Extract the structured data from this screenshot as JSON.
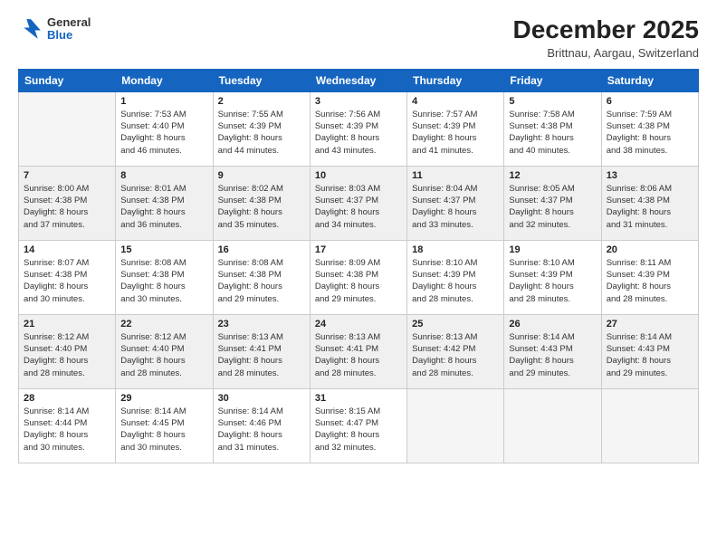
{
  "header": {
    "logo_general": "General",
    "logo_blue": "Blue",
    "month_title": "December 2025",
    "location": "Brittnau, Aargau, Switzerland"
  },
  "days_of_week": [
    "Sunday",
    "Monday",
    "Tuesday",
    "Wednesday",
    "Thursday",
    "Friday",
    "Saturday"
  ],
  "weeks": [
    [
      {
        "day": "",
        "sunrise": "",
        "sunset": "",
        "daylight": "",
        "empty": true
      },
      {
        "day": "1",
        "sunrise": "Sunrise: 7:53 AM",
        "sunset": "Sunset: 4:40 PM",
        "daylight": "Daylight: 8 hours",
        "daylight2": "and 46 minutes."
      },
      {
        "day": "2",
        "sunrise": "Sunrise: 7:55 AM",
        "sunset": "Sunset: 4:39 PM",
        "daylight": "Daylight: 8 hours",
        "daylight2": "and 44 minutes."
      },
      {
        "day": "3",
        "sunrise": "Sunrise: 7:56 AM",
        "sunset": "Sunset: 4:39 PM",
        "daylight": "Daylight: 8 hours",
        "daylight2": "and 43 minutes."
      },
      {
        "day": "4",
        "sunrise": "Sunrise: 7:57 AM",
        "sunset": "Sunset: 4:39 PM",
        "daylight": "Daylight: 8 hours",
        "daylight2": "and 41 minutes."
      },
      {
        "day": "5",
        "sunrise": "Sunrise: 7:58 AM",
        "sunset": "Sunset: 4:38 PM",
        "daylight": "Daylight: 8 hours",
        "daylight2": "and 40 minutes."
      },
      {
        "day": "6",
        "sunrise": "Sunrise: 7:59 AM",
        "sunset": "Sunset: 4:38 PM",
        "daylight": "Daylight: 8 hours",
        "daylight2": "and 38 minutes."
      }
    ],
    [
      {
        "day": "7",
        "sunrise": "Sunrise: 8:00 AM",
        "sunset": "Sunset: 4:38 PM",
        "daylight": "Daylight: 8 hours",
        "daylight2": "and 37 minutes."
      },
      {
        "day": "8",
        "sunrise": "Sunrise: 8:01 AM",
        "sunset": "Sunset: 4:38 PM",
        "daylight": "Daylight: 8 hours",
        "daylight2": "and 36 minutes."
      },
      {
        "day": "9",
        "sunrise": "Sunrise: 8:02 AM",
        "sunset": "Sunset: 4:38 PM",
        "daylight": "Daylight: 8 hours",
        "daylight2": "and 35 minutes."
      },
      {
        "day": "10",
        "sunrise": "Sunrise: 8:03 AM",
        "sunset": "Sunset: 4:37 PM",
        "daylight": "Daylight: 8 hours",
        "daylight2": "and 34 minutes."
      },
      {
        "day": "11",
        "sunrise": "Sunrise: 8:04 AM",
        "sunset": "Sunset: 4:37 PM",
        "daylight": "Daylight: 8 hours",
        "daylight2": "and 33 minutes."
      },
      {
        "day": "12",
        "sunrise": "Sunrise: 8:05 AM",
        "sunset": "Sunset: 4:37 PM",
        "daylight": "Daylight: 8 hours",
        "daylight2": "and 32 minutes."
      },
      {
        "day": "13",
        "sunrise": "Sunrise: 8:06 AM",
        "sunset": "Sunset: 4:38 PM",
        "daylight": "Daylight: 8 hours",
        "daylight2": "and 31 minutes."
      }
    ],
    [
      {
        "day": "14",
        "sunrise": "Sunrise: 8:07 AM",
        "sunset": "Sunset: 4:38 PM",
        "daylight": "Daylight: 8 hours",
        "daylight2": "and 30 minutes."
      },
      {
        "day": "15",
        "sunrise": "Sunrise: 8:08 AM",
        "sunset": "Sunset: 4:38 PM",
        "daylight": "Daylight: 8 hours",
        "daylight2": "and 30 minutes."
      },
      {
        "day": "16",
        "sunrise": "Sunrise: 8:08 AM",
        "sunset": "Sunset: 4:38 PM",
        "daylight": "Daylight: 8 hours",
        "daylight2": "and 29 minutes."
      },
      {
        "day": "17",
        "sunrise": "Sunrise: 8:09 AM",
        "sunset": "Sunset: 4:38 PM",
        "daylight": "Daylight: 8 hours",
        "daylight2": "and 29 minutes."
      },
      {
        "day": "18",
        "sunrise": "Sunrise: 8:10 AM",
        "sunset": "Sunset: 4:39 PM",
        "daylight": "Daylight: 8 hours",
        "daylight2": "and 28 minutes."
      },
      {
        "day": "19",
        "sunrise": "Sunrise: 8:10 AM",
        "sunset": "Sunset: 4:39 PM",
        "daylight": "Daylight: 8 hours",
        "daylight2": "and 28 minutes."
      },
      {
        "day": "20",
        "sunrise": "Sunrise: 8:11 AM",
        "sunset": "Sunset: 4:39 PM",
        "daylight": "Daylight: 8 hours",
        "daylight2": "and 28 minutes."
      }
    ],
    [
      {
        "day": "21",
        "sunrise": "Sunrise: 8:12 AM",
        "sunset": "Sunset: 4:40 PM",
        "daylight": "Daylight: 8 hours",
        "daylight2": "and 28 minutes."
      },
      {
        "day": "22",
        "sunrise": "Sunrise: 8:12 AM",
        "sunset": "Sunset: 4:40 PM",
        "daylight": "Daylight: 8 hours",
        "daylight2": "and 28 minutes."
      },
      {
        "day": "23",
        "sunrise": "Sunrise: 8:13 AM",
        "sunset": "Sunset: 4:41 PM",
        "daylight": "Daylight: 8 hours",
        "daylight2": "and 28 minutes."
      },
      {
        "day": "24",
        "sunrise": "Sunrise: 8:13 AM",
        "sunset": "Sunset: 4:41 PM",
        "daylight": "Daylight: 8 hours",
        "daylight2": "and 28 minutes."
      },
      {
        "day": "25",
        "sunrise": "Sunrise: 8:13 AM",
        "sunset": "Sunset: 4:42 PM",
        "daylight": "Daylight: 8 hours",
        "daylight2": "and 28 minutes."
      },
      {
        "day": "26",
        "sunrise": "Sunrise: 8:14 AM",
        "sunset": "Sunset: 4:43 PM",
        "daylight": "Daylight: 8 hours",
        "daylight2": "and 29 minutes."
      },
      {
        "day": "27",
        "sunrise": "Sunrise: 8:14 AM",
        "sunset": "Sunset: 4:43 PM",
        "daylight": "Daylight: 8 hours",
        "daylight2": "and 29 minutes."
      }
    ],
    [
      {
        "day": "28",
        "sunrise": "Sunrise: 8:14 AM",
        "sunset": "Sunset: 4:44 PM",
        "daylight": "Daylight: 8 hours",
        "daylight2": "and 30 minutes."
      },
      {
        "day": "29",
        "sunrise": "Sunrise: 8:14 AM",
        "sunset": "Sunset: 4:45 PM",
        "daylight": "Daylight: 8 hours",
        "daylight2": "and 30 minutes."
      },
      {
        "day": "30",
        "sunrise": "Sunrise: 8:14 AM",
        "sunset": "Sunset: 4:46 PM",
        "daylight": "Daylight: 8 hours",
        "daylight2": "and 31 minutes."
      },
      {
        "day": "31",
        "sunrise": "Sunrise: 8:15 AM",
        "sunset": "Sunset: 4:47 PM",
        "daylight": "Daylight: 8 hours",
        "daylight2": "and 32 minutes."
      },
      {
        "day": "",
        "sunrise": "",
        "sunset": "",
        "daylight": "",
        "daylight2": "",
        "empty": true
      },
      {
        "day": "",
        "sunrise": "",
        "sunset": "",
        "daylight": "",
        "daylight2": "",
        "empty": true
      },
      {
        "day": "",
        "sunrise": "",
        "sunset": "",
        "daylight": "",
        "daylight2": "",
        "empty": true
      }
    ]
  ]
}
